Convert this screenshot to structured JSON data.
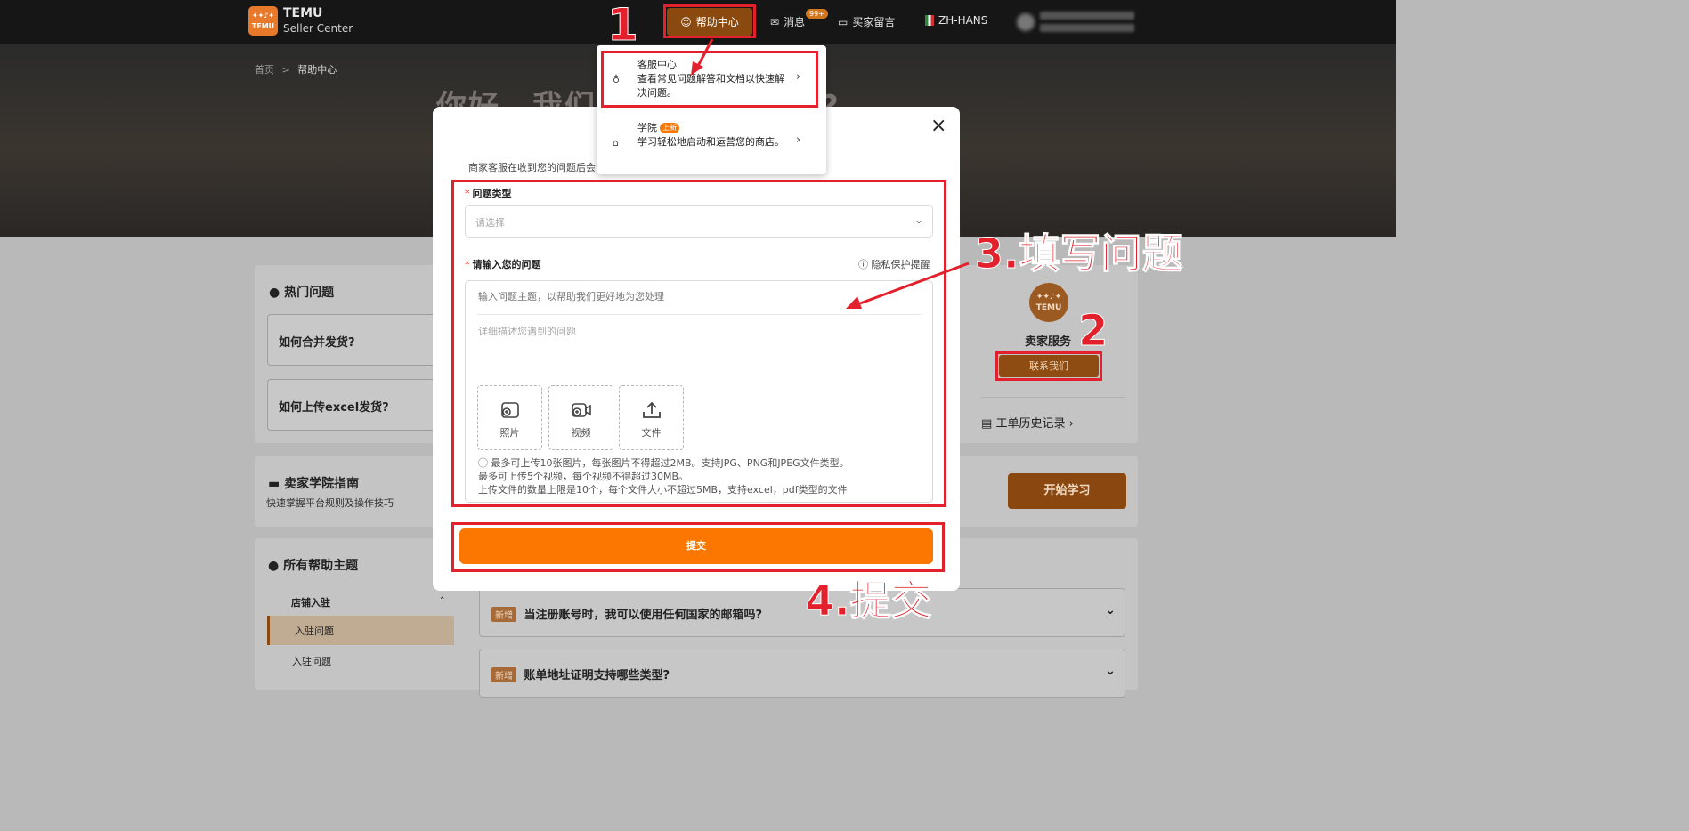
{
  "topbar": {
    "logo_text": "TEMU",
    "brand_title": "TEMU",
    "brand_subtitle": "Seller Center",
    "help_center": "帮助中心",
    "messages": "消息",
    "messages_badge": "99+",
    "buyer_messages": "买家留言",
    "language": "ZH-HANS"
  },
  "breadcrumb": {
    "home": "首页",
    "sep": ">",
    "current": "帮助中心"
  },
  "hero": {
    "title": "你好，我们有什么可以帮助?"
  },
  "hot": {
    "title": "热门问题",
    "questions": [
      "如何合并发货?",
      "如何上传excel发货?"
    ]
  },
  "seller_service": {
    "logo_text": "TEMU",
    "name": "卖家服务",
    "contact_button": "联系我们",
    "history": "工单历史记录"
  },
  "academy": {
    "title": "卖家学院指南",
    "subtitle": "快速掌握平台规则及操作技巧",
    "start_button": "开始学习"
  },
  "topics": {
    "title": "所有帮助主题",
    "group": "店铺入驻",
    "items": [
      "入驻问题",
      "入驻问题"
    ],
    "faqs": [
      {
        "tag": "新增",
        "text": "当注册账号时，我可以使用任何国家的邮箱吗?"
      },
      {
        "tag": "新增",
        "text": "账单地址证明支持哪些类型?"
      }
    ]
  },
  "dropdown": {
    "items": [
      {
        "title": "客服中心",
        "desc": "查看常见问题解答和文档以快速解决问题。",
        "icon": "headset-icon"
      },
      {
        "title": "学院",
        "badge": "上新",
        "desc": "学习轻松地启动和运营您的商店。",
        "icon": "academy-icon"
      }
    ]
  },
  "modal": {
    "close": "×",
    "note": "商家客服在收到您的问题后会",
    "question_type_label": "问题类型",
    "select_placeholder": "请选择",
    "question_label": "请输入您的问题",
    "privacy": "隐私保护提醒",
    "subject_placeholder": "输入问题主题，以帮助我们更好地为您处理",
    "detail_placeholder": "详细描述您遇到的问题",
    "uploads": [
      "照片",
      "视频",
      "文件"
    ],
    "hints": [
      "最多可上传10张图片，每张图片不得超过2MB。支持JPG、PNG和JPEG文件类型。",
      "最多可上传5个视频，每个视频不得超过30MB。",
      "上传文件的数量上限是10个，每个文件大小不超过5MB，支持excel，pdf类型的文件"
    ],
    "submit": "提交"
  },
  "annotations": {
    "step1": "1",
    "step2": "2",
    "step3": "3.填写问题",
    "step4": "4.提交",
    "color": "#e2212d"
  },
  "colors": {
    "accent": "#fb7701",
    "topbar": "#161616"
  }
}
